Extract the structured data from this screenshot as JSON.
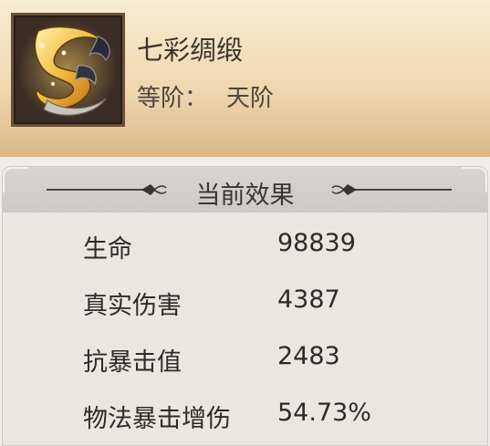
{
  "item": {
    "icon": "golden-serpent-ribbon-icon",
    "name": "七彩绸缎",
    "grade_label": "等阶：",
    "grade_value": "天阶"
  },
  "effects": {
    "title": "当前效果",
    "stats": [
      {
        "label": "生命",
        "value": "98839"
      },
      {
        "label": "真实伤害",
        "value": "4387"
      },
      {
        "label": "抗暴击值",
        "value": "2483"
      },
      {
        "label": "物法暴击增伤",
        "value": "54.73%"
      }
    ]
  },
  "colors": {
    "header_top": "#f9ecd3",
    "header_bottom": "#dbb98a",
    "panel_bg": "#e9e7e2",
    "text": "#2f2a27"
  }
}
